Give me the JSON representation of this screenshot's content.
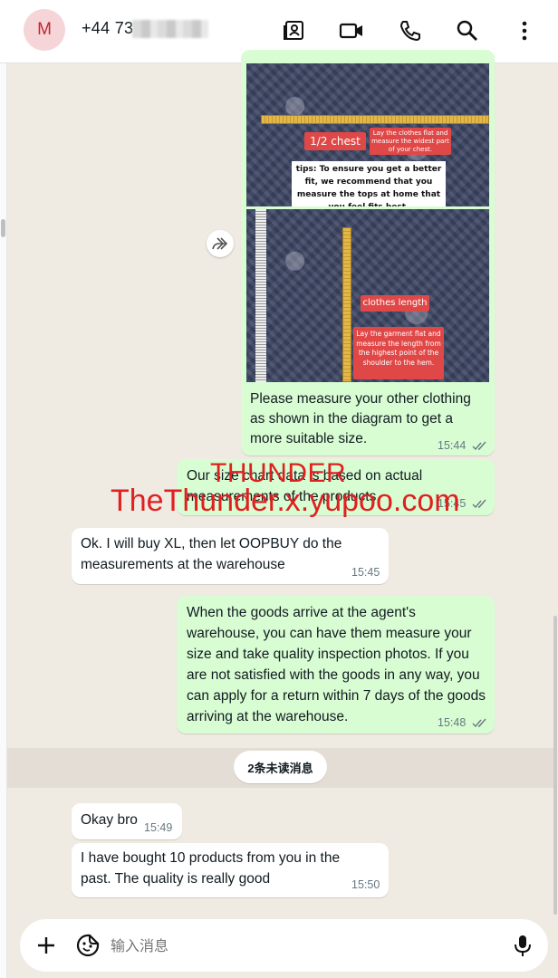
{
  "header": {
    "avatar_letter": "M",
    "contact_name": "+44 73",
    "icons": [
      "contacts-icon",
      "video-call-icon",
      "phone-icon",
      "search-icon",
      "more-vert-icon"
    ]
  },
  "images": {
    "chest_label": "1/2 chest",
    "chest_note": "Lay the clothes flat and measure the widest part of your chest.",
    "tip": "tips: To ensure you get a better fit, we recommend that you measure the tops at home that you feel fits best.",
    "length_label": "clothes length",
    "length_note": "Lay the garment flat and measure the length from the highest point of the shoulder to the hem."
  },
  "messages": [
    {
      "dir": "out",
      "text": "Please measure your other clothing as shown in the diagram to get a more suitable size.",
      "time": "15:44"
    },
    {
      "dir": "out",
      "text": "Our size chart data is based on actual measurements of the products.",
      "time": "15:45"
    },
    {
      "dir": "in",
      "text": "Ok. I will buy XL, then let OOPBUY do the measurements at the warehouse",
      "time": "15:45"
    },
    {
      "dir": "out",
      "text": "When the goods arrive at the agent's warehouse, you can have them measure your size and take quality inspection photos. If you are not satisfied with the goods in any way, you can apply for a return within 7 days of the goods arriving at the warehouse.",
      "time": "15:48"
    },
    {
      "dir": "in",
      "text": "Okay bro",
      "time": "15:49"
    },
    {
      "dir": "in",
      "text": "I have bought 10 products from you in the past. The quality is really good",
      "time": "15:50"
    }
  ],
  "unread_divider": "2条未读消息",
  "watermark": {
    "line1": "THUNDER",
    "line2": "TheThunder.x.yupoo.com"
  },
  "composer": {
    "placeholder": "输入消息"
  },
  "colors": {
    "outgoing": "#d9fdd3",
    "incoming": "#ffffff",
    "background": "#efeae2",
    "watermark": "#e02020"
  }
}
